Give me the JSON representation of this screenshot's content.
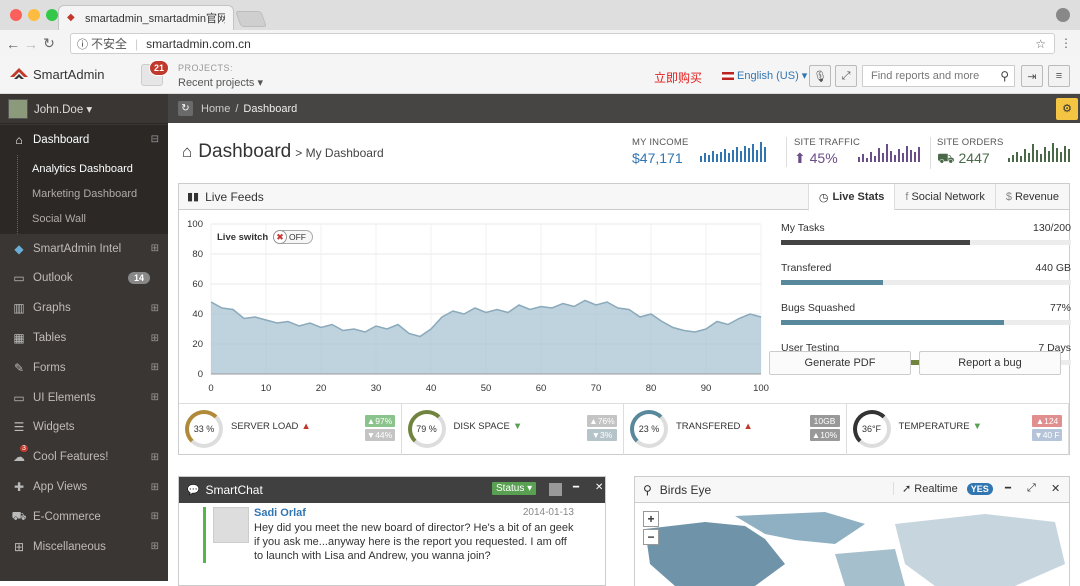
{
  "browser": {
    "tab_title": "smartadmin_smartadmin官网_x",
    "insecure_label": "不安全",
    "url": "smartadmin.com.cn"
  },
  "header": {
    "brand": "SmartAdmin",
    "notification_count": "21",
    "projects_label": "PROJECTS:",
    "projects_value": "Recent projects ▾",
    "buy_link": "立即购买",
    "language": "English (US) ▾",
    "search_placeholder": "Find reports and more"
  },
  "sidebar": {
    "user": "John.Doe ▾",
    "items": [
      {
        "label": "Dashboard",
        "icon": "home-icon"
      },
      {
        "label": "SmartAdmin Intel",
        "icon": "cube-icon"
      },
      {
        "label": "Outlook",
        "icon": "inbox-icon",
        "count": "14"
      },
      {
        "label": "Graphs",
        "icon": "bar-chart-icon"
      },
      {
        "label": "Tables",
        "icon": "table-icon"
      },
      {
        "label": "Forms",
        "icon": "edit-icon"
      },
      {
        "label": "UI Elements",
        "icon": "desktop-icon"
      },
      {
        "label": "Widgets",
        "icon": "list-icon"
      },
      {
        "label": "Cool Features!",
        "icon": "cloud-icon",
        "badge": "3"
      },
      {
        "label": "App Views",
        "icon": "puzzle-icon"
      },
      {
        "label": "E-Commerce",
        "icon": "cart-icon"
      },
      {
        "label": "Miscellaneous",
        "icon": "windows-icon"
      }
    ],
    "subitems": [
      "Analytics Dashboard",
      "Marketing Dashboard",
      "Social Wall"
    ]
  },
  "breadcrumb": {
    "home": "Home",
    "sep": "/",
    "current": "Dashboard"
  },
  "page": {
    "title": "Dashboard",
    "subtitle": "> My Dashboard"
  },
  "stats": [
    {
      "label": "MY INCOME",
      "value": "$47,171",
      "color": "#3276b1"
    },
    {
      "label": "SITE TRAFFIC",
      "value": "45%",
      "color": "#6a4e87"
    },
    {
      "label": "SITE ORDERS",
      "value": "2447",
      "color": "#496949"
    }
  ],
  "live_feeds": {
    "title": "Live Feeds",
    "tabs": [
      "Live Stats",
      "Social Network",
      "Revenue"
    ],
    "switch_label": "Live switch",
    "switch_state": "OFF",
    "tasks": [
      {
        "label": "My Tasks",
        "value": "130/200",
        "fraction": 0.65,
        "color": "#434343"
      },
      {
        "label": "Transfered",
        "value": "440 GB",
        "fraction": 0.35,
        "color": "#57889c"
      },
      {
        "label": "Bugs Squashed",
        "value": "77%",
        "fraction": 0.77,
        "color": "#57889c"
      },
      {
        "label": "User Testing",
        "value": "7 Days",
        "fraction": 0.84,
        "color": "#71843f"
      }
    ],
    "buttons": [
      "Generate PDF",
      "Report a bug"
    ]
  },
  "chart_data": {
    "type": "area",
    "x": [
      0,
      2,
      4,
      6,
      8,
      10,
      12,
      14,
      16,
      18,
      20,
      22,
      24,
      26,
      28,
      30,
      32,
      34,
      36,
      38,
      40,
      42,
      44,
      46,
      48,
      50,
      52,
      54,
      56,
      58,
      60,
      62,
      64,
      66,
      68,
      70,
      72,
      74,
      76,
      78,
      80,
      82,
      84,
      86,
      88,
      90,
      92,
      94,
      96,
      98,
      100
    ],
    "values": [
      48,
      44,
      43,
      37,
      38,
      36,
      34,
      35,
      32,
      34,
      31,
      33,
      29,
      30,
      28,
      32,
      30,
      33,
      27,
      25,
      30,
      38,
      42,
      40,
      44,
      41,
      43,
      41,
      46,
      43,
      45,
      44,
      47,
      45,
      49,
      46,
      48,
      44,
      43,
      38,
      40,
      35,
      31,
      29,
      28,
      30,
      35,
      33,
      37,
      40,
      38
    ],
    "ylim": [
      0,
      100
    ],
    "xlim": [
      0,
      100
    ],
    "yticks": [
      0,
      20,
      40,
      60,
      80,
      100
    ],
    "xticks": [
      0,
      10,
      20,
      30,
      40,
      50,
      60,
      70,
      80,
      90,
      100
    ],
    "color": "#aac4d3"
  },
  "gauges": [
    {
      "value": "33 %",
      "label": "SERVER LOAD",
      "trend": "up",
      "ring_color": "#b08a3a",
      "chips": [
        {
          "text": "▲97%",
          "color": "#8ac38b"
        },
        {
          "text": "▼44%",
          "color": "#c4c4c4"
        }
      ]
    },
    {
      "value": "79 %",
      "label": "DISK SPACE",
      "trend": "down",
      "ring_color": "#71843f",
      "chips": [
        {
          "text": "▲76%",
          "color": "#c4c4c4"
        },
        {
          "text": "▼3%",
          "color": "#b5c4c9"
        }
      ]
    },
    {
      "value": "23 %",
      "label": "TRANSFERED",
      "trend": "up",
      "ring_color": "#57889c",
      "chips": [
        {
          "text": "10GB",
          "color": "#999"
        },
        {
          "text": "▲10%",
          "color": "#999"
        }
      ]
    },
    {
      "value": "36°F",
      "label": "TEMPERATURE",
      "trend": "down",
      "ring_color": "#333",
      "chips": [
        {
          "text": "▲124",
          "color": "#e08e8e"
        },
        {
          "text": "▼40 F",
          "color": "#b5c4d9"
        }
      ]
    }
  ],
  "smartchat": {
    "title": "SmartChat",
    "status_label": "Status ▾",
    "sender": "Sadi Orlaf",
    "date": "2014-01-13",
    "message": "Hey did you meet the new board of director? He's a bit of an geek if you ask me...anyway here is the report you requested. I am off to launch with Lisa and Andrew, you wanna join?"
  },
  "birds_eye": {
    "title": "Birds Eye",
    "realtime_label": "Realtime",
    "realtime_state": "YES"
  }
}
